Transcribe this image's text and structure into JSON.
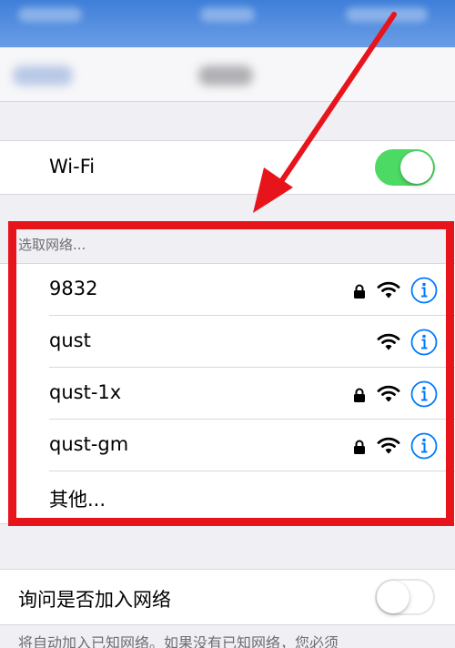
{
  "wifi": {
    "label": "Wi-Fi",
    "enabled": true
  },
  "networks_section": {
    "header": "选取网络...",
    "items": [
      {
        "name": "9832",
        "locked": true,
        "icon": "wifi-icon"
      },
      {
        "name": "qust",
        "locked": false,
        "icon": "wifi-icon"
      },
      {
        "name": "qust-1x",
        "locked": true,
        "icon": "wifi-icon"
      },
      {
        "name": "qust-gm",
        "locked": true,
        "icon": "wifi-icon"
      }
    ],
    "other_label": "其他..."
  },
  "ask_to_join": {
    "label": "询问是否加入网络",
    "enabled": false
  },
  "footer_text": "将自动加入已知网络。如果没有已知网络，您必须",
  "colors": {
    "toggle_on": "#4cd964",
    "accent": "#007aff",
    "annotation": "#e8141b",
    "background": "#efeff4"
  }
}
